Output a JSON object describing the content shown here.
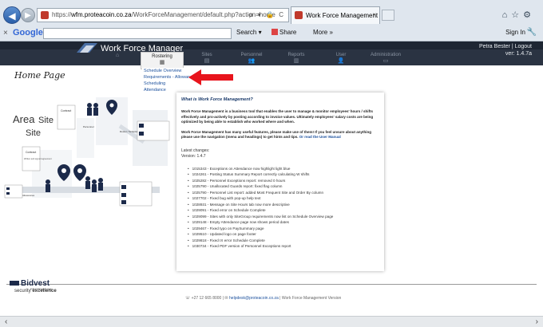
{
  "browser": {
    "url_prefix": "https://",
    "url_domain": "wfm.proteacoin.co.za",
    "url_path": "/WorkForceManagement/default.php?action=home",
    "address_tools": "ρ ▾ 🔒 C",
    "tab_title": "Work Force Management",
    "tab_close": "×"
  },
  "google_bar": {
    "close": "×",
    "logo": "Google",
    "search_label": "Search ▾",
    "share_label": "Share",
    "more_label": "More »",
    "signin_label": "Sign In"
  },
  "app": {
    "title": "Work Force Manager",
    "user_name": "Petra Bester | Logout",
    "version_badge": "ver: 1.4.7a",
    "menu": [
      {
        "label": "",
        "icon": "⌂"
      },
      {
        "label": "Rostering",
        "icon": "▦"
      },
      {
        "label": "Sites",
        "icon": "▤"
      },
      {
        "label": "Personnel",
        "icon": "👥"
      },
      {
        "label": "Reports",
        "icon": "▥"
      },
      {
        "label": "User",
        "icon": "👤"
      },
      {
        "label": "Administration",
        "icon": "▭"
      }
    ],
    "dropdown": [
      "Schedule Overview",
      "Requirements - Allowances",
      "Scheduling",
      "Attendance"
    ]
  },
  "page": {
    "title": "Home Page",
    "illustration": {
      "area": "Area",
      "site1": "Site",
      "site2": "Site",
      "contract": "Contract",
      "contract_note": "Written and signed agreement",
      "personnel": "Personnel",
      "rostering": "Roster / Schedule",
      "allowances": "Allowances",
      "requirements": "Requirements"
    },
    "info_heading": "What is Work Force Management?",
    "para1": "Work Force Management is a business tool that enables the user to manage & monitor employees' hours / shifts effectively and pro-actively by posting according to invoice values. Ultimately employees' salary costs are being optimized by being able to establish who worked where and when.",
    "para2_a": "Work Force Management has many useful features, please make use of them! If you feel unsure about anything please use the navigation (menu and headings) to get hints and tips. ",
    "para2_link": "Or read the User Manual",
    "latest_changes": "Latest changes:",
    "version": "Version: 1.4.7",
    "changes": [
      "1015343 - Exceptions on Attendance now highlight light blue",
      "1024261 - Posting Status Summary Report correctly calculating W shifts",
      "1025282 - Personnel Exceptions report: removed 0 hours",
      "1025790 - Unallocated Guards report: fixed flag column",
      "1025790 - Personnel List report: added Most Frequent Site and Order By column",
      "1027702 - Fixed bug with pop-up help text",
      "1028931 - Message on Site Hours tab now more descriptive",
      "1029091 - Fixed error on Schedule Complete",
      "1029099 - Sites with only SiteGroup requirements now list on Schedule Overview page",
      "1029148 - Empty Attendance page now shows period dates",
      "1029467 - Fixed typo on PaySummary page",
      "1029510 - Updated logo on page footer",
      "1029818 - Fixed IX error Schedule Complete",
      "1030734 - Fixed PDF version of Personnel Exceptions report"
    ]
  },
  "footer": {
    "brand": "Bidvest",
    "brand_sub": "PROTEA COIN",
    "security_a": "security ",
    "security_b": "excellence",
    "phone": "+27 12 665 8000 |",
    "email": "helpdesk@proteacoin.co.za",
    "tail": " | Work Force Management Version"
  },
  "colors": {
    "header_bg": "#2a3342",
    "link": "#1a4f9c",
    "arrow": "#e8141c"
  }
}
